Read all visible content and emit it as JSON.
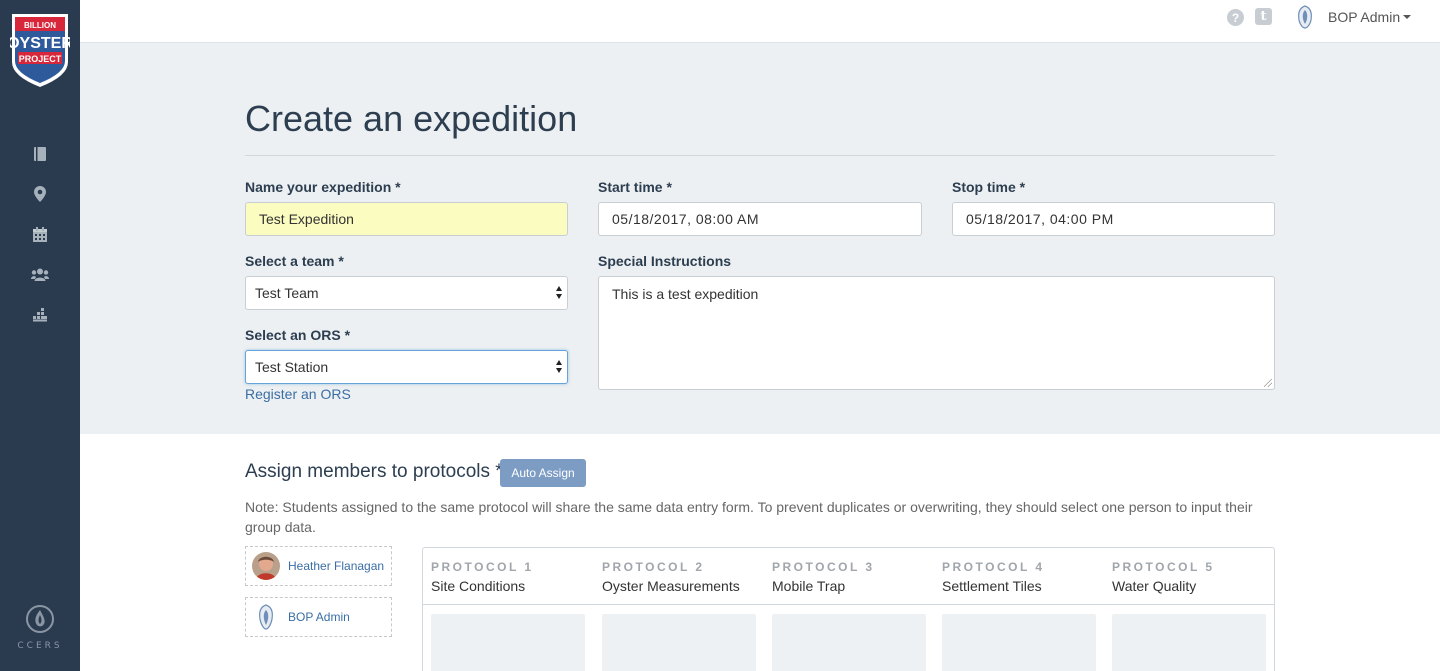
{
  "brand": {
    "logo_line1": "BILLION",
    "logo_line2": "OYSTER",
    "logo_line3": "PROJECT",
    "footer_logo_text": "CCERS"
  },
  "sidebar": {
    "icons": [
      "book-icon",
      "map-marker-icon",
      "calendar-icon",
      "users-icon",
      "sitemap-icon"
    ]
  },
  "topbar": {
    "help_glyph": "?",
    "t_glyph": "t",
    "user_name": "BOP Admin"
  },
  "form": {
    "title": "Create an expedition",
    "name_label": "Name your expedition *",
    "name_value": "Test Expedition",
    "start_label": "Start time *",
    "start_value": "05/18/2017, 08:00 AM",
    "stop_label": "Stop time *",
    "stop_value": "05/18/2017, 04:00 PM",
    "team_label": "Select a team *",
    "team_value": "Test Team",
    "instructions_label": "Special Instructions",
    "instructions_value": "This is a test expedition",
    "ors_label": "Select an ORS *",
    "ors_value": "Test Station",
    "register_link": "Register an ORS"
  },
  "protocols": {
    "title": "Assign members to protocols *",
    "auto_assign_label": "Auto Assign",
    "note": "Note: Students assigned to the same protocol will share the same data entry form. To prevent duplicates or overwriting, they should select one person to input their group data.",
    "members": [
      {
        "name": "Heather Flanagan"
      },
      {
        "name": "BOP Admin"
      }
    ],
    "columns": [
      {
        "number": "PROTOCOL 1",
        "name": "Site Conditions"
      },
      {
        "number": "PROTOCOL 2",
        "name": "Oyster Measurements"
      },
      {
        "number": "PROTOCOL 3",
        "name": "Mobile Trap"
      },
      {
        "number": "PROTOCOL 4",
        "name": "Settlement Tiles"
      },
      {
        "number": "PROTOCOL 5",
        "name": "Water Quality"
      }
    ]
  },
  "colors": {
    "sidebar_bg": "#2a3b4f",
    "form_bg": "#edf0f2",
    "highlight_input": "#fbfcc0",
    "link": "#3a6ea5",
    "auto_assign_button": "#7d9cc4"
  }
}
